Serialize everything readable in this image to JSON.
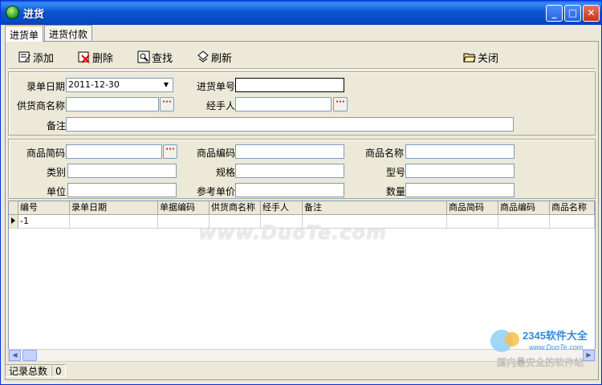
{
  "window": {
    "title": "进货",
    "minimize": "_",
    "maximize": "□",
    "close": "✕"
  },
  "tabs": [
    {
      "label": "进货单",
      "active": true
    },
    {
      "label": "进货付款",
      "active": false
    }
  ],
  "toolbar": {
    "add": "添加",
    "delete": "删除",
    "find": "查找",
    "refresh": "刷新",
    "close": "关闭"
  },
  "form": {
    "entry_date_label": "录单日期",
    "entry_date_value": "2011-12-30",
    "purchase_no_label": "进货单号",
    "purchase_no_value": "",
    "supplier_label": "供货商名称",
    "supplier_value": "",
    "handler_label": "经手人",
    "handler_value": "",
    "remark_label": "备注",
    "remark_value": "",
    "ellipsis": "···"
  },
  "product": {
    "code_short_label": "商品简码",
    "code_label": "商品编码",
    "name_label": "商品名称",
    "category_label": "类别",
    "spec_label": "规格",
    "model_label": "型号",
    "unit_label": "单位",
    "ref_price_label": "参考单价",
    "qty_label": "数量"
  },
  "grid": {
    "columns": [
      "编号",
      "录单日期",
      "单据编码",
      "供货商名称",
      "经手人",
      "备注",
      "商品简码",
      "商品编码",
      "商品名称"
    ],
    "rows": [
      [
        "-1",
        "",
        "",
        "",
        "",
        "",
        "",
        "",
        ""
      ]
    ]
  },
  "status": {
    "total_label": "记录总数",
    "total_value": "0"
  },
  "watermark": "www.DuoTe.com",
  "logo": {
    "brand": "2345软件大全",
    "url": "www.DuoTe.com",
    "slogan": "国内最安全的软件站"
  },
  "colors": {
    "titlebar": "#0b57d0",
    "face": "#ece9d8",
    "field_border": "#7f9db9"
  }
}
